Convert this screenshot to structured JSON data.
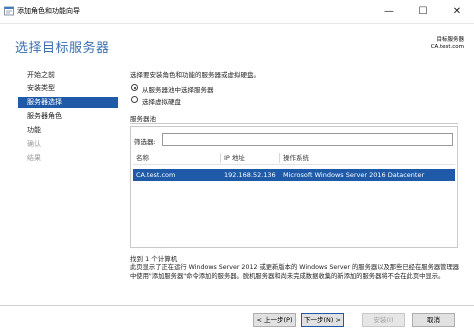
{
  "window": {
    "title": "添加角色和功能向导",
    "minimize_glyph": "—",
    "maximize_glyph": "☐",
    "close_glyph": "✕"
  },
  "header": {
    "page_title": "选择目标服务器",
    "destination_label": "目标服务器",
    "destination_value": "CA.test.com"
  },
  "nav": {
    "items": [
      {
        "label": "开始之前",
        "state": "normal"
      },
      {
        "label": "安装类型",
        "state": "normal"
      },
      {
        "label": "服务器选择",
        "state": "active"
      },
      {
        "label": "服务器角色",
        "state": "normal"
      },
      {
        "label": "功能",
        "state": "normal"
      },
      {
        "label": "确认",
        "state": "disabled"
      },
      {
        "label": "结果",
        "state": "disabled"
      }
    ]
  },
  "main": {
    "instruction": "选择要安装角色和功能的服务器或虚拟硬盘。",
    "radio_pool": "从服务器池中选择服务器",
    "radio_vhd": "选择虚拟硬盘",
    "pool_label": "服务器池",
    "filter_label": "筛选器:",
    "filter_value": "",
    "columns": [
      "名称",
      "IP 地址",
      "操作系统"
    ],
    "rows": [
      {
        "name": "CA.test.com",
        "ip": "192.168.52.136",
        "os": "Microsoft Windows Server 2016 Datacenter"
      }
    ],
    "found_text": "找到 1 个计算机",
    "description": "此页显示了正在运行 Windows Server 2012 或更新版本的 Windows Server 的服务器以及那些已经在服务器管理器中使用\"添加服务器\"命令添加的服务器。脱机服务器和尚未完成数据收集的新添加的服务器将不会在此页中显示。"
  },
  "footer": {
    "prev": "< 上一步(P)",
    "next": "下一步(N) >",
    "install": "安装(I)",
    "cancel": "取消"
  },
  "colors": {
    "accent": "#1e5aa8",
    "title_blue": "#3a6fb0"
  }
}
